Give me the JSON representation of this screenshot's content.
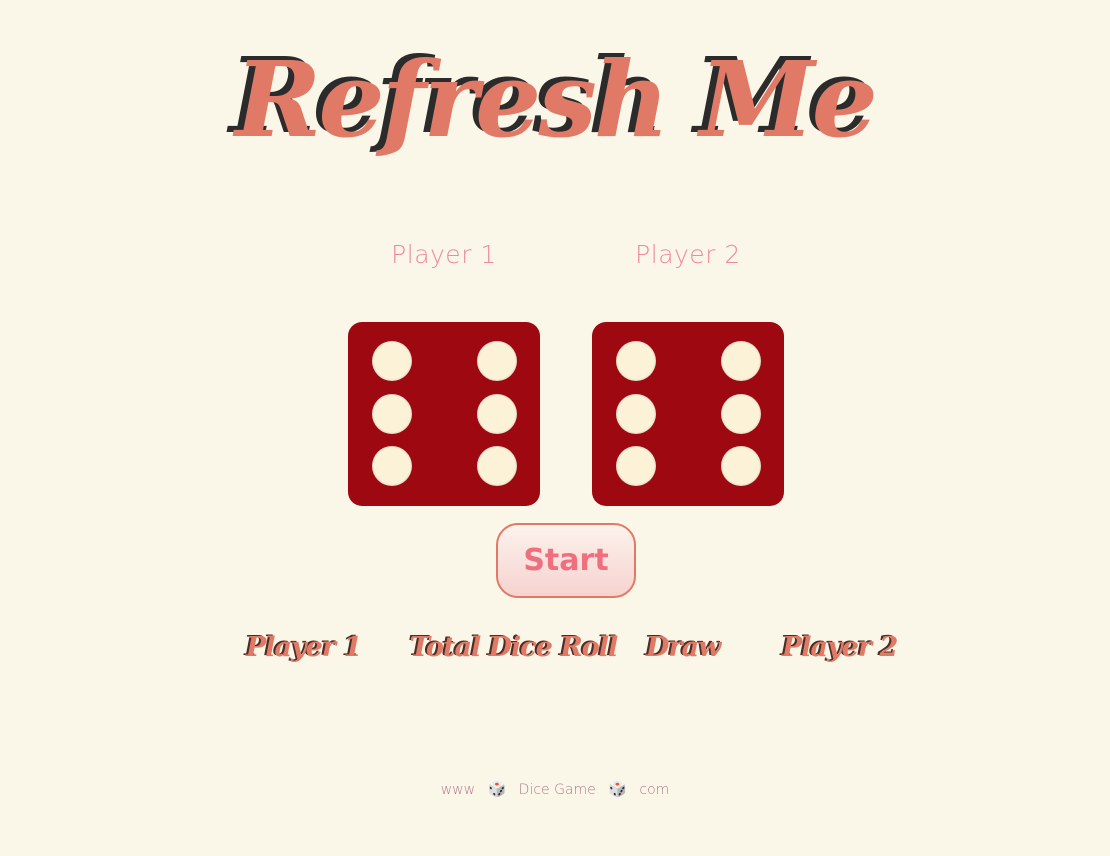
{
  "title": "Refresh Me",
  "players": {
    "p1_label": "Player 1",
    "p2_label": "Player 2"
  },
  "dice": {
    "player1_value": 6,
    "player2_value": 6
  },
  "colors": {
    "background": "#fbf7e8",
    "accent": "#e07a66",
    "die_face": "#9e0810",
    "pip": "#fcf2d8",
    "label_pink": "#ee8a9a"
  },
  "start_button": {
    "label": "Start"
  },
  "scoreboard": {
    "player1": "Player 1",
    "total": "Total Dice Roll",
    "draw": "Draw",
    "player2": "Player 2"
  },
  "footer": {
    "part1": "www",
    "dice_icon": "🎲",
    "part2": "Dice Game",
    "part3": "com"
  }
}
